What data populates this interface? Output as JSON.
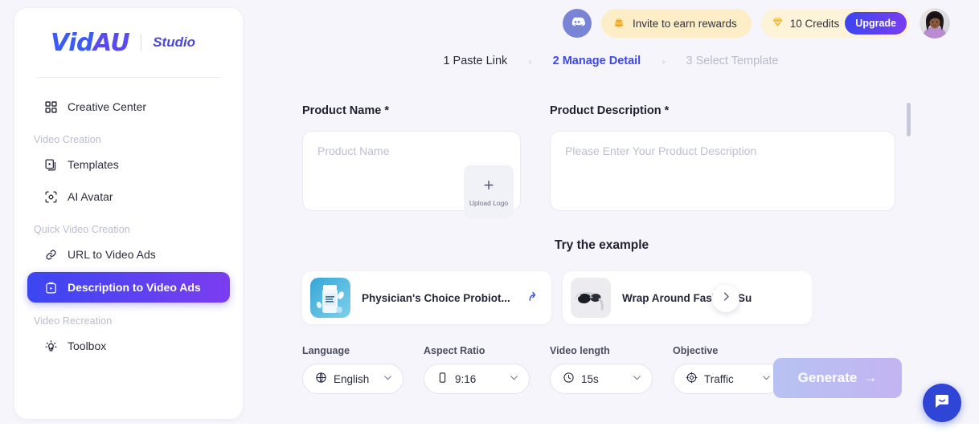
{
  "brand": {
    "logo_primary": "Vid",
    "logo_secondary": "AU",
    "studio": "Studio"
  },
  "sidebar": {
    "items": [
      {
        "label": "Creative Center",
        "icon": "grid-icon",
        "type": "item",
        "active": false
      },
      {
        "label": "Video Creation",
        "icon": "",
        "type": "group"
      },
      {
        "label": "Templates",
        "icon": "templates-icon",
        "type": "item",
        "active": false
      },
      {
        "label": "AI Avatar",
        "icon": "ai-avatar-icon",
        "type": "item",
        "active": false
      },
      {
        "label": "Quick Video Creation",
        "icon": "",
        "type": "group"
      },
      {
        "label": "URL to Video Ads",
        "icon": "link-icon",
        "type": "item",
        "active": false
      },
      {
        "label": "Description to Video Ads",
        "icon": "description-video-icon",
        "type": "item",
        "active": true
      },
      {
        "label": "Video Recreation",
        "icon": "",
        "type": "group"
      },
      {
        "label": "Toolbox",
        "icon": "toolbox-idea-icon",
        "type": "item",
        "active": false
      }
    ]
  },
  "header": {
    "discord_icon": "discord-icon",
    "invite": {
      "label": "Invite to earn rewards",
      "icon": "coins-icon"
    },
    "credits": {
      "label": "10 Credits",
      "icon": "gem-icon"
    },
    "upgrade_label": "Upgrade",
    "avatar_name": "user-avatar"
  },
  "stepper": {
    "steps": [
      {
        "label": "1 Paste Link",
        "state": "done"
      },
      {
        "label": "2 Manage Detail",
        "state": "active"
      },
      {
        "label": "3 Select Template",
        "state": "pending"
      }
    ],
    "separator": "›"
  },
  "form": {
    "product_name": {
      "label": "Product Name *",
      "placeholder": "Product Name",
      "value": ""
    },
    "product_description": {
      "label": "Product Description *",
      "placeholder": "Please Enter Your Product Description",
      "value": ""
    },
    "upload_logo": {
      "label": "Upload Logo",
      "icon": "plus-icon"
    }
  },
  "examples": {
    "title": "Try the example",
    "items": [
      {
        "name": "Physician's Choice Probiot...",
        "thumb": "probiotic-bottle",
        "action_icon": "use-example-arrow-icon"
      },
      {
        "name": "Wrap Around Fashion Su",
        "thumb": "sunglasses",
        "action_icon": ""
      }
    ],
    "next_icon": "chevron-right-icon"
  },
  "selects": [
    {
      "label": "Language",
      "value": "English",
      "icon": "globe-icon",
      "name": "language-select"
    },
    {
      "label": "Aspect Ratio",
      "value": "9:16",
      "icon": "phone-portrait-icon",
      "name": "aspect-ratio-select"
    },
    {
      "label": "Video length",
      "value": "15s",
      "icon": "clock-icon",
      "name": "video-length-select"
    },
    {
      "label": "Objective",
      "value": "Traffic",
      "icon": "target-icon",
      "name": "objective-select"
    }
  ],
  "generate": {
    "label": "Generate",
    "arrow": "→"
  },
  "chat": {
    "icon": "chat-bubble-icon"
  },
  "colors": {
    "brand_blue": "#3b46f1",
    "brand_purple": "#7b3df0",
    "page_bg": "#f5f5fb",
    "credits_bg": "#fdf3d8",
    "invite_bg": "#fdeec7"
  }
}
